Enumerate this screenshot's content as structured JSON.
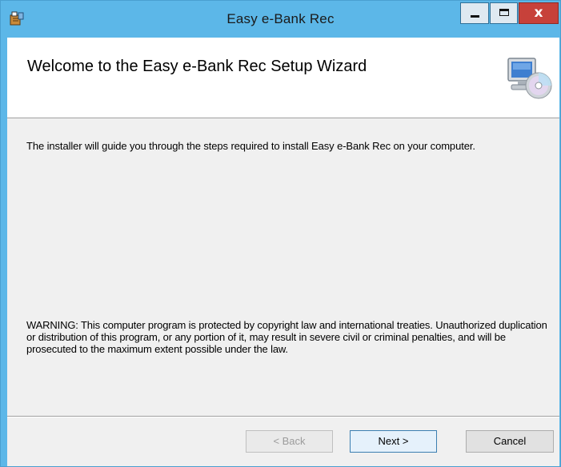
{
  "window": {
    "title": "Easy e-Bank Rec",
    "controls": {
      "close_glyph": "x"
    },
    "icons": {
      "app": "installer-box-icon",
      "banner": "computer-cd-icon"
    }
  },
  "wizard": {
    "heading": "Welcome to the Easy e-Bank Rec Setup Wizard",
    "intro": "The installer will guide you through the steps required to install Easy e-Bank Rec on your computer.",
    "warning": "WARNING: This computer program is protected by copyright law and international treaties. Unauthorized duplication or distribution of this program, or any portion of it, may result in severe civil or criminal penalties, and will be prosecuted to the maximum extent possible under the law."
  },
  "buttons": {
    "back": "< Back",
    "next": "Next >",
    "cancel": "Cancel"
  },
  "colors": {
    "titlebar": "#5cb7e8",
    "close": "#c7413a",
    "dialog_bg": "#f0f0f0",
    "banner_bg": "#ffffff"
  }
}
